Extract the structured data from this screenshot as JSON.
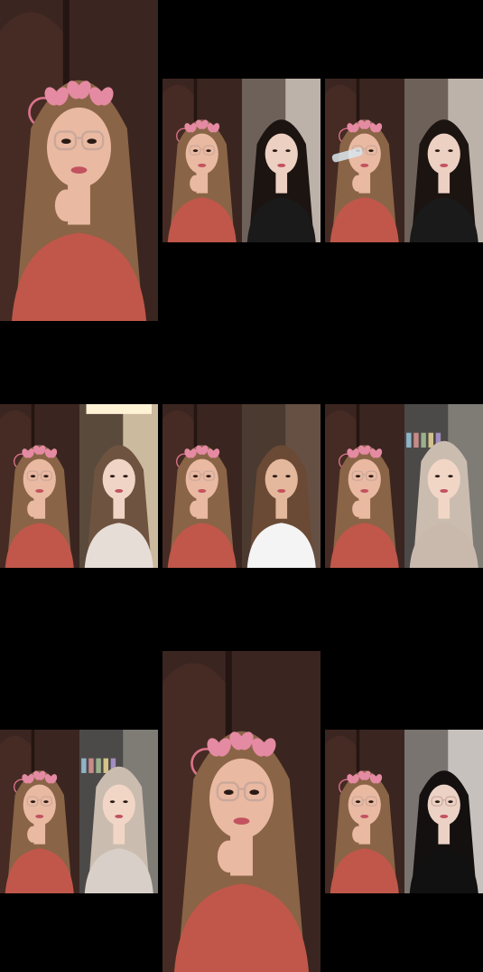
{
  "grid": {
    "cells": [
      {
        "id": "r1c1",
        "layout": "single",
        "frames": [
          {
            "subject": "host",
            "backdrop": "wardrobe",
            "palette": {
              "bg": "#3b2520",
              "bg2": "#241512",
              "skin": "#e9b9a2",
              "hair": "#8a6446",
              "top": "#c0574a"
            }
          }
        ]
      },
      {
        "id": "r1c2",
        "layout": "split",
        "frames": [
          {
            "subject": "host",
            "backdrop": "wardrobe",
            "palette": {
              "bg": "#3b2520",
              "bg2": "#241512",
              "skin": "#e9b9a2",
              "hair": "#8a6446",
              "top": "#c0574a"
            }
          },
          {
            "subject": "guest",
            "backdrop": "light-room",
            "palette": {
              "bg": "#6d6159",
              "bg2": "#cfc7bd",
              "skin": "#ecd0c2",
              "hair": "#1b1411",
              "top": "#1a1a1a"
            }
          }
        ]
      },
      {
        "id": "r1c3",
        "layout": "split",
        "frames": [
          {
            "subject": "host-drinking",
            "backdrop": "wardrobe",
            "palette": {
              "bg": "#3b2520",
              "bg2": "#241512",
              "skin": "#e9b9a2",
              "hair": "#8a6446",
              "top": "#c0574a"
            }
          },
          {
            "subject": "guest",
            "backdrop": "light-room",
            "palette": {
              "bg": "#6d6159",
              "bg2": "#cfc7bd",
              "skin": "#ecd0c2",
              "hair": "#1b1411",
              "top": "#1a1a1a"
            }
          }
        ]
      },
      {
        "id": "r2c1",
        "layout": "split",
        "frames": [
          {
            "subject": "host",
            "backdrop": "wardrobe",
            "palette": {
              "bg": "#3b2520",
              "bg2": "#241512",
              "skin": "#e9b9a2",
              "hair": "#8a6446",
              "top": "#c0574a"
            }
          },
          {
            "subject": "guest",
            "backdrop": "ceiling-lights",
            "palette": {
              "bg": "#5a4a3c",
              "bg2": "#e8d6b8",
              "skin": "#f0d5c6",
              "hair": "#6e5340",
              "top": "#e6ddd6"
            }
          }
        ]
      },
      {
        "id": "r2c2",
        "layout": "split",
        "frames": [
          {
            "subject": "host",
            "backdrop": "wardrobe",
            "palette": {
              "bg": "#3b2520",
              "bg2": "#241512",
              "skin": "#e9b9a2",
              "hair": "#8a6446",
              "top": "#c0574a"
            }
          },
          {
            "subject": "guest",
            "backdrop": "brown-wall",
            "palette": {
              "bg": "#4a3a30",
              "bg2": "#6b5648",
              "skin": "#e4b89c",
              "hair": "#6a4a34",
              "top": "#f4f4f4"
            }
          }
        ]
      },
      {
        "id": "r2c3",
        "layout": "split",
        "frames": [
          {
            "subject": "host",
            "backdrop": "wardrobe",
            "palette": {
              "bg": "#3b2520",
              "bg2": "#241512",
              "skin": "#e9b9a2",
              "hair": "#8a6446",
              "top": "#c0574a"
            }
          },
          {
            "subject": "guest-hijab",
            "backdrop": "shelves",
            "palette": {
              "bg": "#4c4a48",
              "bg2": "#8c8882",
              "skin": "#f1d6c6",
              "hair": "#cbbcb0",
              "top": "#c9b9ad"
            }
          }
        ]
      },
      {
        "id": "r3c1",
        "layout": "split",
        "frames": [
          {
            "subject": "host",
            "backdrop": "wardrobe",
            "palette": {
              "bg": "#3b2520",
              "bg2": "#241512",
              "skin": "#e9b9a2",
              "hair": "#8a6446",
              "top": "#c0574a"
            }
          },
          {
            "subject": "guest-hijab",
            "backdrop": "shelves",
            "palette": {
              "bg": "#4c4a48",
              "bg2": "#8c8882",
              "skin": "#f1d6c6",
              "hair": "#cbbcb0",
              "top": "#d8cfc8"
            }
          }
        ]
      },
      {
        "id": "r3c2",
        "layout": "single-tall",
        "frames": [
          {
            "subject": "host",
            "backdrop": "wardrobe",
            "palette": {
              "bg": "#3b2520",
              "bg2": "#241512",
              "skin": "#e9b9a2",
              "hair": "#8a6446",
              "top": "#c0574a"
            }
          }
        ]
      },
      {
        "id": "r3c3",
        "layout": "split",
        "frames": [
          {
            "subject": "host",
            "backdrop": "wardrobe",
            "palette": {
              "bg": "#3b2520",
              "bg2": "#241512",
              "skin": "#e9b9a2",
              "hair": "#8a6446",
              "top": "#c0574a"
            }
          },
          {
            "subject": "guest-glasses",
            "backdrop": "light-room",
            "palette": {
              "bg": "#7a7470",
              "bg2": "#d9d5d0",
              "skin": "#ecd2c4",
              "hair": "#141010",
              "top": "#111111"
            }
          }
        ]
      }
    ]
  }
}
